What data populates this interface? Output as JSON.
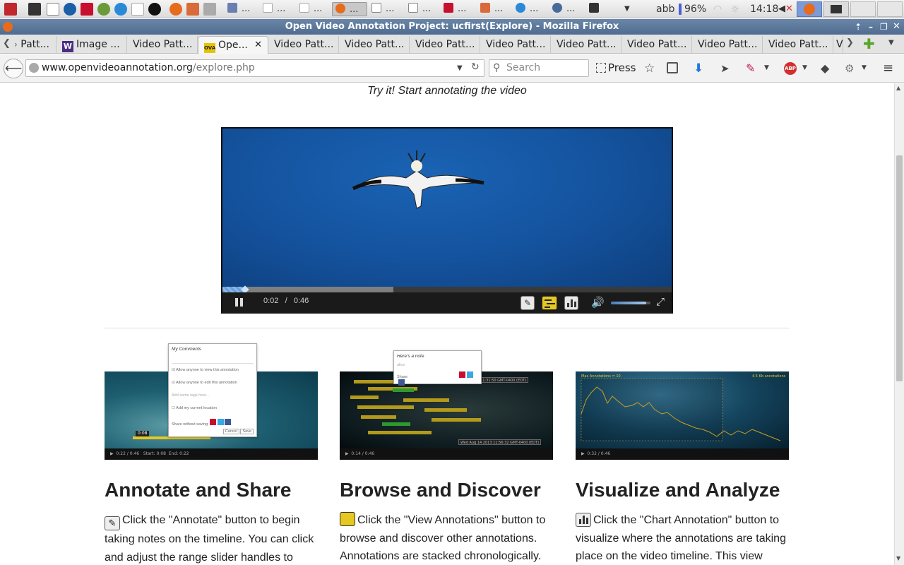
{
  "taskbar": {
    "keyboard_layout": "abb",
    "battery": "96%",
    "clock": "14:18",
    "tasks": [
      "...",
      "...",
      "...",
      "...",
      "...",
      "...",
      "...",
      "...",
      "...",
      "..."
    ]
  },
  "window": {
    "title": "Open Video Annotation Project: ucfirst(Explore) - Mozilla Firefox"
  },
  "tabs": [
    {
      "label": "Patt...",
      "favicon": "page"
    },
    {
      "label": "Image ...",
      "favicon": "w-logo"
    },
    {
      "label": "Video Patt...",
      "favicon": "none"
    },
    {
      "label": "Ope...",
      "favicon": "ova-logo",
      "active": true
    },
    {
      "label": "Video Patt...",
      "favicon": "none"
    },
    {
      "label": "Video Patt...",
      "favicon": "none"
    },
    {
      "label": "Video Patt...",
      "favicon": "none"
    },
    {
      "label": "Video Patt...",
      "favicon": "none"
    },
    {
      "label": "Video Patt...",
      "favicon": "none"
    },
    {
      "label": "Video Patt...",
      "favicon": "none"
    },
    {
      "label": "Video Patt...",
      "favicon": "none"
    },
    {
      "label": "Video Patt...",
      "favicon": "none"
    },
    {
      "label": "V",
      "favicon": "none"
    }
  ],
  "navbar": {
    "url_domain": "www.openvideoannotation.org",
    "url_path": "/explore.php",
    "search_placeholder": "Search",
    "press_label": "Press"
  },
  "page": {
    "tagline": "Try it! Start annotating the video",
    "player": {
      "current_time": "0:02",
      "separator": "/",
      "duration": "0:46",
      "progress_fraction": 0.05,
      "buffered_fraction": 0.38,
      "volume_fraction": 0.9
    },
    "features": [
      {
        "title": "Annotate and Share",
        "icon": "annotate-icon",
        "text": "Click the \"Annotate\" button to begin taking notes on the timeline. You can click and adjust the range slider handles to",
        "popup": {
          "header": "My Comments",
          "opt1": "Allow anyone to view this annotation",
          "opt2": "Allow anyone to edit this annotation",
          "tags": "Add some tags here...",
          "location": "Add my current location",
          "share": "Share without saving:",
          "cancel": "Cancel",
          "save": "Save",
          "time": "0:08"
        }
      },
      {
        "title": "Browse and Discover",
        "icon": "view-annotations-icon",
        "text": "Click the \"View Annotations\" button to browse and discover other annotations. Annotations are stacked chronologically.",
        "popup": {
          "header": "Here's a note",
          "user": "alice",
          "share": "Share:",
          "date1": "Wed Aug 14 2013 11:31:50 GMT-0400 (EDT)",
          "date2": "Wed Aug 14 2013 11:56:32 GMT-0400 (EDT)"
        }
      },
      {
        "title": "Visualize and Analyze",
        "icon": "chart-icon",
        "text": "Click the \"Chart Annotation\" button to visualize where the annotations are taking place on the video timeline. This view",
        "chart": {
          "label_left": "Max Annotations = 10",
          "label_right": "4.5 Kb annotations"
        }
      }
    ]
  },
  "colors": {
    "titlebar": "#5a7698",
    "video_blue": "#1554a0",
    "highlight_yellow": "#e5c820",
    "thumb_sea": "#0e5a6a"
  }
}
